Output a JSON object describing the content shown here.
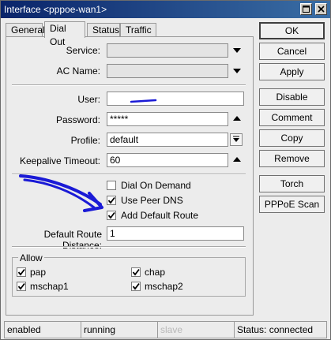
{
  "window": {
    "title": "Interface <pppoe-wan1>"
  },
  "tabs": [
    {
      "label": "General",
      "active": false
    },
    {
      "label": "Dial Out",
      "active": true
    },
    {
      "label": "Status",
      "active": false
    },
    {
      "label": "Traffic",
      "active": false
    }
  ],
  "form": {
    "service": {
      "label": "Service:",
      "value": ""
    },
    "ac_name": {
      "label": "AC Name:",
      "value": ""
    },
    "user": {
      "label": "User:",
      "value": ""
    },
    "password": {
      "label": "Password:",
      "value": "*****"
    },
    "profile": {
      "label": "Profile:",
      "value": "default"
    },
    "keepalive": {
      "label": "Keepalive Timeout:",
      "value": "60"
    },
    "dial_on_demand": {
      "label": "Dial On Demand",
      "checked": false
    },
    "use_peer_dns": {
      "label": "Use Peer DNS",
      "checked": true
    },
    "add_default_route": {
      "label": "Add Default Route",
      "checked": true
    },
    "default_route_distance": {
      "label": "Default Route Distance:",
      "value": "1"
    }
  },
  "allow": {
    "title": "Allow",
    "items": [
      {
        "label": "pap",
        "checked": true
      },
      {
        "label": "chap",
        "checked": true
      },
      {
        "label": "mschap1",
        "checked": true
      },
      {
        "label": "mschap2",
        "checked": true
      }
    ]
  },
  "buttons": {
    "ok": "OK",
    "cancel": "Cancel",
    "apply": "Apply",
    "disable": "Disable",
    "comment": "Comment",
    "copy": "Copy",
    "remove": "Remove",
    "torch": "Torch",
    "pppoe_scan": "PPPoE Scan"
  },
  "statusbar": {
    "state": "enabled",
    "running": "running",
    "slave": "slave",
    "status": "Status: connected"
  },
  "colors": {
    "titlebar": "#0a246a",
    "annotation_arrow": "#1a1ad6",
    "panel_bg": "#ececec"
  }
}
